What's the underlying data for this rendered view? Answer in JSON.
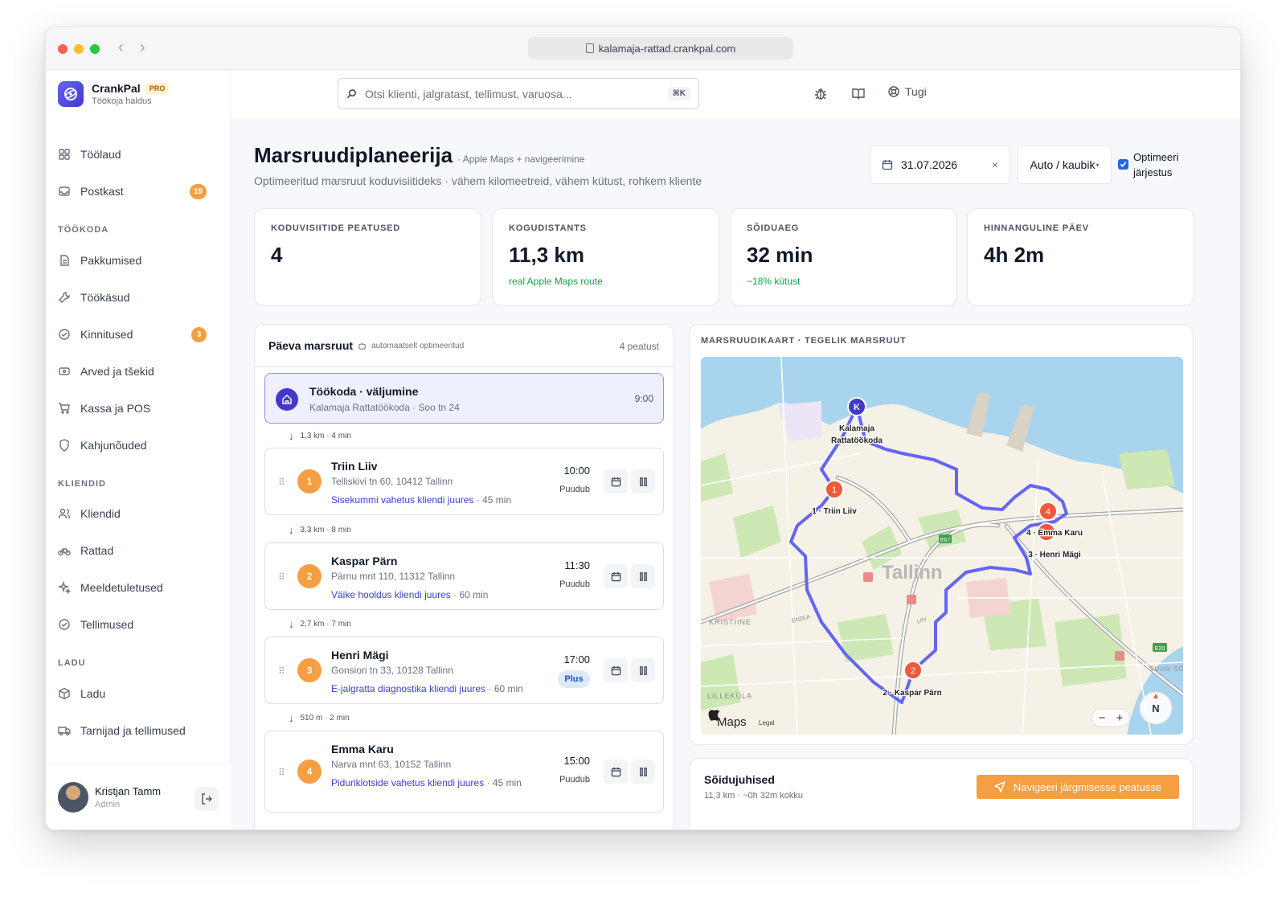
{
  "browser": {
    "url": "kalamaja-rattad.crankpal.com"
  },
  "brand": {
    "name": "CrankPal",
    "badge": "PRO",
    "subtitle": "Töökoja haldus"
  },
  "sidebar": {
    "items": [
      {
        "label": "Töölaud",
        "icon": "dashboard-icon"
      },
      {
        "label": "Postkast",
        "icon": "inbox-icon",
        "badge": "19"
      },
      {
        "section": "TÖÖKODA"
      },
      {
        "label": "Pakkumised",
        "icon": "document-icon"
      },
      {
        "label": "Töökäsud",
        "icon": "wrench-icon"
      },
      {
        "label": "Kinnitused",
        "icon": "check-circle-icon",
        "badge": "3"
      },
      {
        "label": "Arved ja tšekid",
        "icon": "receipt-icon"
      },
      {
        "label": "Kassa ja POS",
        "icon": "cart-icon"
      },
      {
        "label": "Kahjunõuded",
        "icon": "shield-icon"
      },
      {
        "section": "KLIENDID"
      },
      {
        "label": "Kliendid",
        "icon": "users-icon"
      },
      {
        "label": "Rattad",
        "icon": "bike-icon"
      },
      {
        "label": "Meeldetuletused",
        "icon": "sparkle-icon"
      },
      {
        "label": "Tellimused",
        "icon": "check-circle-icon"
      },
      {
        "section": "LADU"
      },
      {
        "label": "Ladu",
        "icon": "box-icon"
      },
      {
        "label": "Tarnijad ja tellimused",
        "icon": "truck-icon"
      }
    ],
    "user": {
      "name": "Kristjan Tamm",
      "role": "Admin"
    }
  },
  "topbar": {
    "search_placeholder": "Otsi klienti, jalgratast, tellimust, varuosa...",
    "search_shortcut": "⌘K",
    "support_label": "Tugi"
  },
  "page": {
    "title": "Marsruudiplaneerija",
    "title_sub": "· Apple Maps + navigeerimine",
    "description": "Optimeeritud marsruut koduvisiitideks · vähem kilomeetreid, vähem kütust, rohkem kliente",
    "date": "31.07.2026",
    "vehicle": "Auto / kaubik",
    "optimize_label": "Optimeeri järjestus",
    "optimize_checked": true
  },
  "stats": [
    {
      "label": "KODUVISIITIDE PEATUSED",
      "value": "4",
      "note": ""
    },
    {
      "label": "KOGUDISTANTS",
      "value": "11,3 km",
      "note": "real Apple Maps route"
    },
    {
      "label": "SÕIDUAEG",
      "value": "32 min",
      "note": "−18% kütust"
    },
    {
      "label": "HINNANGULINE PÄEV",
      "value": "4h 2m",
      "note": ""
    }
  ],
  "route": {
    "title": "Päeva marsruut",
    "subtitle": "automaatselt optimeeritud",
    "count": "4 peatust",
    "depot": {
      "title": "Töökoda · väljumine",
      "subtitle": "Kalamaja Rattatöökoda · Soo tn 24",
      "time": "9:00"
    },
    "segments": [
      "1,3 km · 4 min",
      "3,3 km · 8 min",
      "2,7 km · 7 min",
      "510 m · 2 min"
    ],
    "stops": [
      {
        "num": "1",
        "name": "Triin Liiv",
        "address": "Telliskivi tn 60, 10412 Tallinn",
        "job": "Sisekummi vahetus kliendi juures",
        "duration": "· 45 min",
        "time": "10:00",
        "status": "Puudub"
      },
      {
        "num": "2",
        "name": "Kaspar Pärn",
        "address": "Pärnu mnt 110, 11312 Tallinn",
        "job": "Väike hooldus kliendi juures",
        "duration": "· 60 min",
        "time": "11:30",
        "status": "Puudub"
      },
      {
        "num": "3",
        "name": "Henri Mägi",
        "address": "Gonsiori tn 33, 10128 Tallinn",
        "job": "E-jalgratta diagnostika kliendi juures",
        "duration": "· 60 min",
        "time": "17:00",
        "status": "Plus"
      },
      {
        "num": "4",
        "name": "Emma Karu",
        "address": "Narva mnt 63, 10152 Tallinn",
        "job": "Piduriklotside vahetus kliendi juures",
        "duration": "· 45 min",
        "time": "15:00",
        "status": "Puudub"
      }
    ]
  },
  "map": {
    "header": "MARSRUUDIKAART · TEGELIK MARSRUUT",
    "city_label": "Tallinn",
    "district_labels": [
      "KRISTIINE",
      "LILLEKÜLA",
      "SUUR-SÕ",
      "ENDLA",
      "LIIV"
    ],
    "depot_marker": "K",
    "depot_label_line1": "Kalamaja",
    "depot_label_line2": "Rattatöökoda",
    "stop_labels": [
      "1 · Triin Liiv",
      "2 · Kaspar Pärn",
      "3 · Henri Mägi",
      "4 · Emma Karu"
    ],
    "road_shields": [
      "E67",
      "E20"
    ],
    "attribution": "Maps",
    "legal": "Legal",
    "compass": "N",
    "zoom_out": "−",
    "zoom_in": "+",
    "route_color": "#6366f1",
    "marker_color": "#ef5a3c"
  },
  "directions": {
    "title": "Sõidujuhised",
    "summary": "11,3 km · ~0h 32m kokku",
    "button": "Navigeeri järgmisesse peatusse"
  }
}
